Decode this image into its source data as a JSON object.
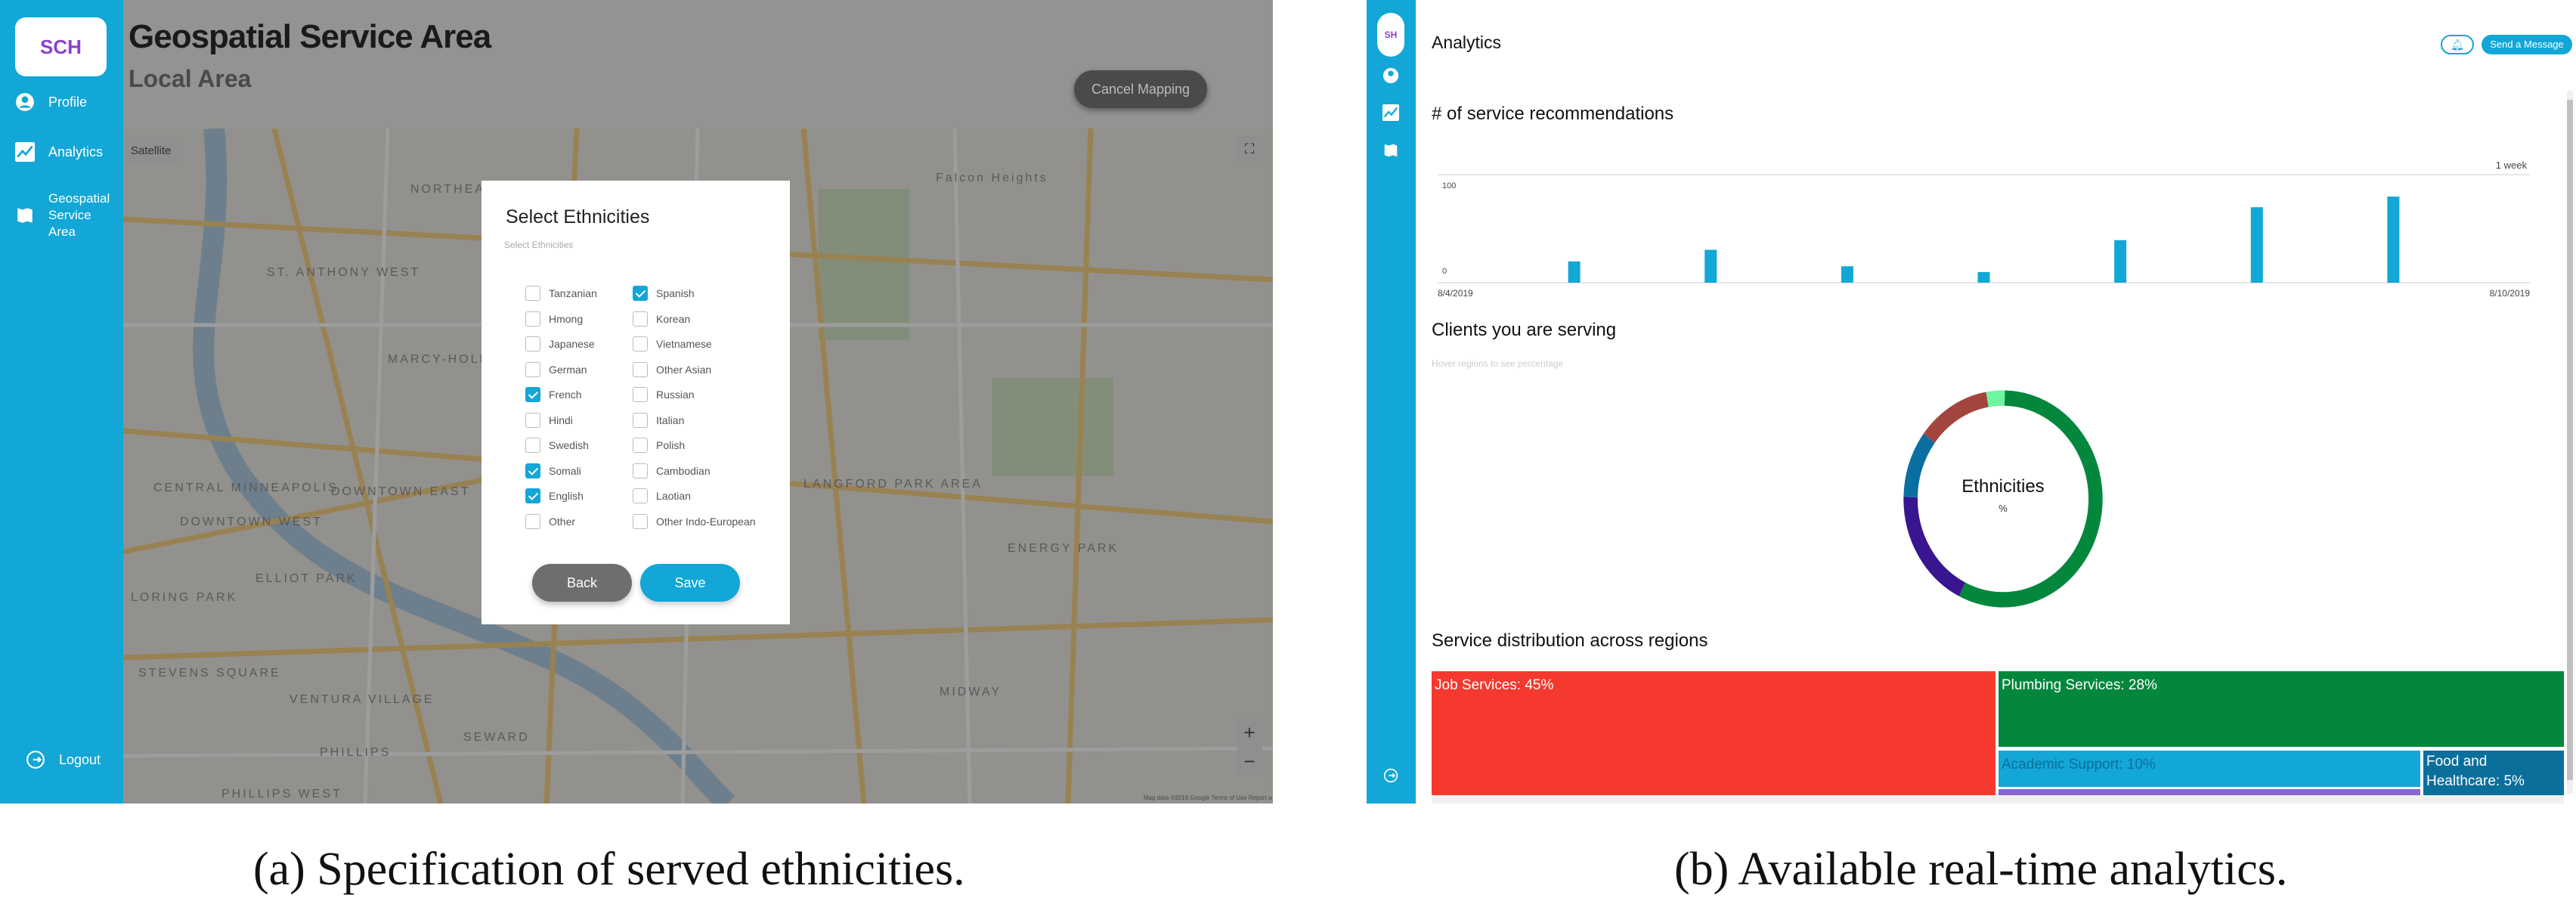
{
  "panel_a": {
    "sidebar": {
      "logo_text": "SCH",
      "items": [
        {
          "label": "Profile",
          "icon": "user-circle-icon"
        },
        {
          "label": "Analytics",
          "icon": "chart-line-icon"
        },
        {
          "label": "Geospatial Service Area",
          "icon": "map-icon"
        }
      ],
      "logout": "Logout"
    },
    "header": {
      "title": "Geospatial Service Area",
      "subtitle": "Local Area",
      "cancel_button": "Cancel Mapping"
    },
    "map": {
      "satellite_button": "Satellite",
      "labels": [
        "NORTHEAST PARK",
        "ST. ANTHONY WEST",
        "MARCY-HOLMES",
        "DOWNTOWN EAST",
        "DOWNTOWN WEST",
        "CENTRAL MINNEAPOLIS",
        "ELLIOT PARK",
        "LORING PARK",
        "STEVENS SQUARE",
        "VENTURA VILLAGE",
        "PHILLIPS",
        "SEWARD",
        "LANGFORD PARK AREA",
        "ENERGY PARK",
        "MIDWAY",
        "Falcon Heights",
        "PHILLIPS WEST"
      ],
      "attribution": "Map data ©2019 Google  Terms of Use  Report a map error"
    },
    "dialog": {
      "title": "Select Ethnicities",
      "subtitle": "Select Ethnicities",
      "col1": [
        {
          "label": "Tanzanian",
          "checked": false
        },
        {
          "label": "Hmong",
          "checked": false
        },
        {
          "label": "Japanese",
          "checked": false
        },
        {
          "label": "German",
          "checked": false
        },
        {
          "label": "French",
          "checked": true
        },
        {
          "label": "Hindi",
          "checked": false
        },
        {
          "label": "Swedish",
          "checked": false
        },
        {
          "label": "Somali",
          "checked": true
        },
        {
          "label": "English",
          "checked": true
        },
        {
          "label": "Other",
          "checked": false
        }
      ],
      "col2": [
        {
          "label": "Spanish",
          "checked": true
        },
        {
          "label": "Korean",
          "checked": false
        },
        {
          "label": "Vietnamese",
          "checked": false
        },
        {
          "label": "Other Asian",
          "checked": false
        },
        {
          "label": "Russian",
          "checked": false
        },
        {
          "label": "Italian",
          "checked": false
        },
        {
          "label": "Polish",
          "checked": false
        },
        {
          "label": "Cambodian",
          "checked": false
        },
        {
          "label": "Laotian",
          "checked": false
        },
        {
          "label": "Other Indo-European",
          "checked": false
        }
      ],
      "back_button": "Back",
      "save_button": "Save"
    },
    "caption": "(a) Specification of served ethnicities."
  },
  "panel_b": {
    "header": {
      "title": "Analytics",
      "send_button": "Send a Message",
      "bell_icon": "bell-icon"
    },
    "sections": {
      "recommendations": "# of service recommendations",
      "clients": "Clients you are serving",
      "clients_hint": "Hover regions to see percentage",
      "distribution": "Service distribution across regions"
    },
    "donut": {
      "center_label": "Ethnicities",
      "center_sub": "%"
    },
    "caption": "(b) Available real-time analytics."
  },
  "colors": {
    "accent": "#12a7d6",
    "bar": "#12a7d6"
  },
  "chart_data": [
    {
      "type": "bar",
      "range_label": "1 week",
      "x_start_label": "8/4/2019",
      "x_end_label": "8/10/2019",
      "ytick_labels": [
        "100",
        "0"
      ],
      "ylim": [
        0,
        100
      ],
      "values": [
        22,
        34,
        17,
        11,
        44,
        78,
        89
      ]
    },
    {
      "type": "pie",
      "segments": [
        {
          "share": 57,
          "color": "#03873d"
        },
        {
          "share": 18,
          "color": "#3a1590"
        },
        {
          "share": 10,
          "color": "#0a6fa0"
        },
        {
          "share": 12,
          "color": "#a3453f"
        },
        {
          "share": 3,
          "color": "#6ff5a0"
        }
      ]
    },
    {
      "type": "treemap",
      "items": [
        {
          "label": "Job Services: 45%",
          "value": 45,
          "color": "#f5392e"
        },
        {
          "label": "Plumbing Services: 28%",
          "value": 28,
          "color": "#03873d"
        },
        {
          "label": "Academic Support: 10%",
          "value": 10,
          "color": "#12a7d6"
        },
        {
          "label": "Food and Healthcare: 5%",
          "value": 5,
          "color": "#0b6f9c"
        }
      ]
    }
  ]
}
